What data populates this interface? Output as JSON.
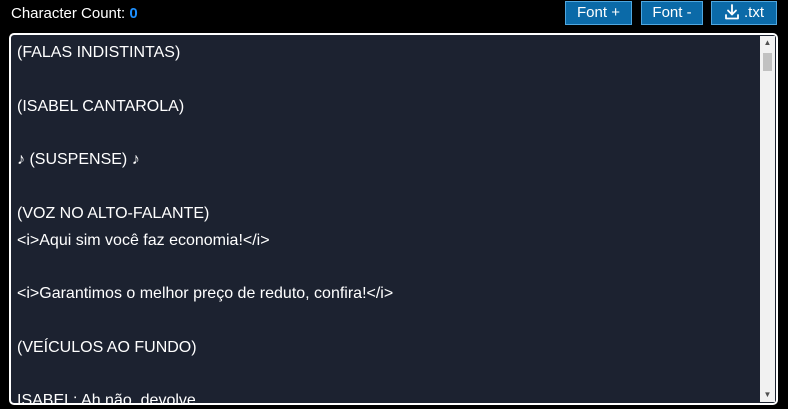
{
  "header": {
    "count_label": "Character Count:",
    "count_value": "0"
  },
  "toolbar": {
    "font_plus_label": "Font +",
    "font_minus_label": "Font -",
    "download_label": ".txt"
  },
  "editor": {
    "content": "(FALAS INDISTINTAS)\n\n(ISABEL CANTAROLA)\n\n♪ (SUSPENSE) ♪\n\n(VOZ NO ALTO-FALANTE)\n<i>Aqui sim você faz economia!</i>\n\n<i>Garantimos o melhor preço de reduto, confira!</i>\n\n(VEÍCULOS AO FUNDO)\n\nISABEL: Ah não, devolve..."
  },
  "icons": {
    "download": "download-icon",
    "scroll_up": "scroll-up-arrow-icon",
    "scroll_down": "scroll-down-arrow-icon"
  },
  "colors": {
    "background": "#000000",
    "editor_background": "#1c2230",
    "button_background": "#0b6aa8",
    "count_accent": "#1e90ff"
  }
}
